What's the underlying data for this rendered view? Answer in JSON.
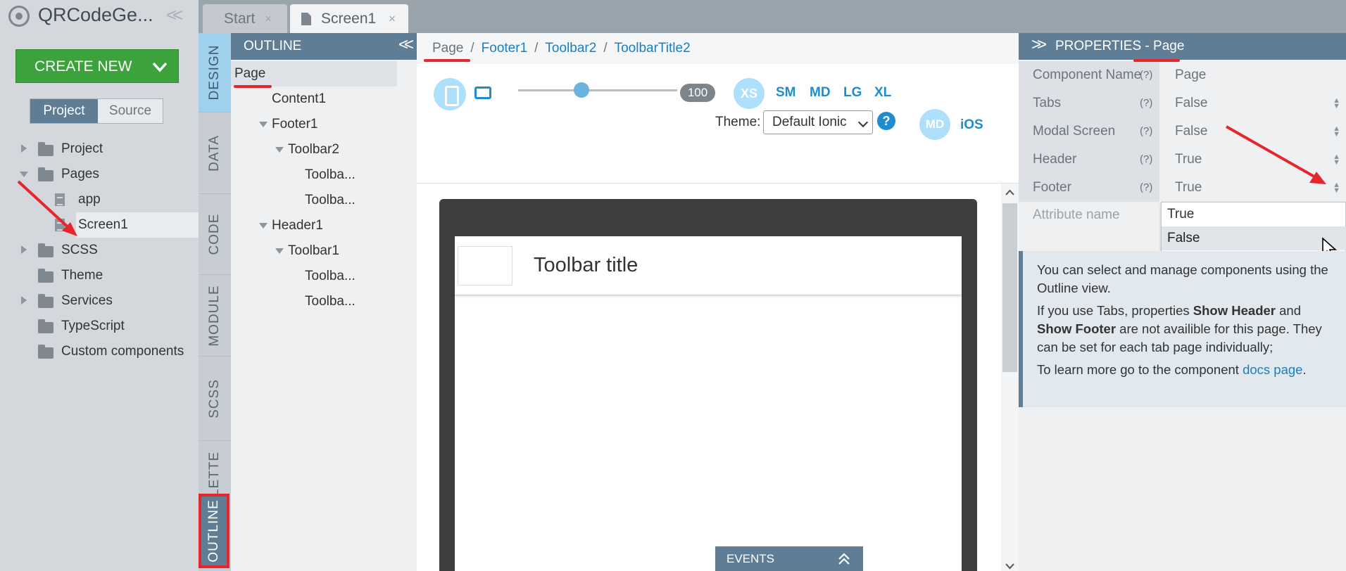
{
  "project_panel": {
    "app_title": "QRCodeGe...",
    "create_new_label": "CREATE NEW",
    "segments": [
      "Project",
      "Source"
    ],
    "tree": [
      {
        "label": "Project",
        "type": "folder",
        "expandable": true
      },
      {
        "label": "Pages",
        "type": "folder",
        "expanded": true
      },
      {
        "label": "app",
        "type": "file"
      },
      {
        "label": "Screen1",
        "type": "file",
        "selected": true
      },
      {
        "label": "SCSS",
        "type": "folder",
        "expandable": true
      },
      {
        "label": "Theme",
        "type": "folder"
      },
      {
        "label": "Services",
        "type": "folder",
        "expandable": true
      },
      {
        "label": "TypeScript",
        "type": "folder"
      },
      {
        "label": "Custom components",
        "type": "folder"
      }
    ]
  },
  "tabs": [
    {
      "label": "Start",
      "close": "×"
    },
    {
      "label": "Screen1",
      "close": "×",
      "active": true
    }
  ],
  "vertical_nav": [
    "DESIGN",
    "DATA",
    "CODE",
    "MODULE",
    "SCSS",
    "PALETTE",
    "OUTLINE"
  ],
  "outline": {
    "title": "OUTLINE",
    "items": [
      "Page",
      "Content1",
      "Footer1",
      "Toolbar2",
      "Toolba...",
      "Toolba...",
      "Header1",
      "Toolbar1",
      "Toolba...",
      "Toolba..."
    ]
  },
  "breadcrumb": {
    "items": [
      "Page",
      "Footer1",
      "Toolbar2",
      "ToolbarTitle2"
    ],
    "separator": "/"
  },
  "device_bar": {
    "zoom": "100",
    "zoom_fraction": 0.4,
    "breakpoints": [
      "XS",
      "SM",
      "MD",
      "LG",
      "XL"
    ],
    "theme_label": "Theme:",
    "theme_value": "Default Ionic",
    "help": "?",
    "modes": [
      "MD",
      "iOS"
    ]
  },
  "canvas": {
    "toolbar_title": "Toolbar title",
    "events_label": "EVENTS"
  },
  "properties": {
    "title_prefix": "PROPERTIES - ",
    "title_target": "Page",
    "help_mark": "(?)",
    "rows": [
      {
        "key": "Component Name",
        "value": "Page"
      },
      {
        "key": "Tabs",
        "value": "False"
      },
      {
        "key": "Modal Screen",
        "value": "False"
      },
      {
        "key": "Header",
        "value": "True"
      },
      {
        "key": "Footer",
        "value": "True"
      }
    ],
    "attribute_placeholder": "Attribute name",
    "dropdown_options": [
      "True",
      "False"
    ],
    "info": {
      "p1": "You can select and manage components using the Outline view.",
      "p2_a": "If you use Tabs, properties ",
      "p2_b": "Show Header",
      "p2_c": " and ",
      "p2_d": "Show Footer",
      "p2_e": " are not availible for this page. They can be set for each tab page individually;",
      "p3_a": "To learn more go to the component ",
      "p3_link": "docs page",
      "p3_b": "."
    }
  },
  "colors": {
    "accent": "#5f7d95",
    "create_green": "#3ca33c",
    "link_blue": "#1a7fc0",
    "annotation_red": "#e5262c"
  }
}
